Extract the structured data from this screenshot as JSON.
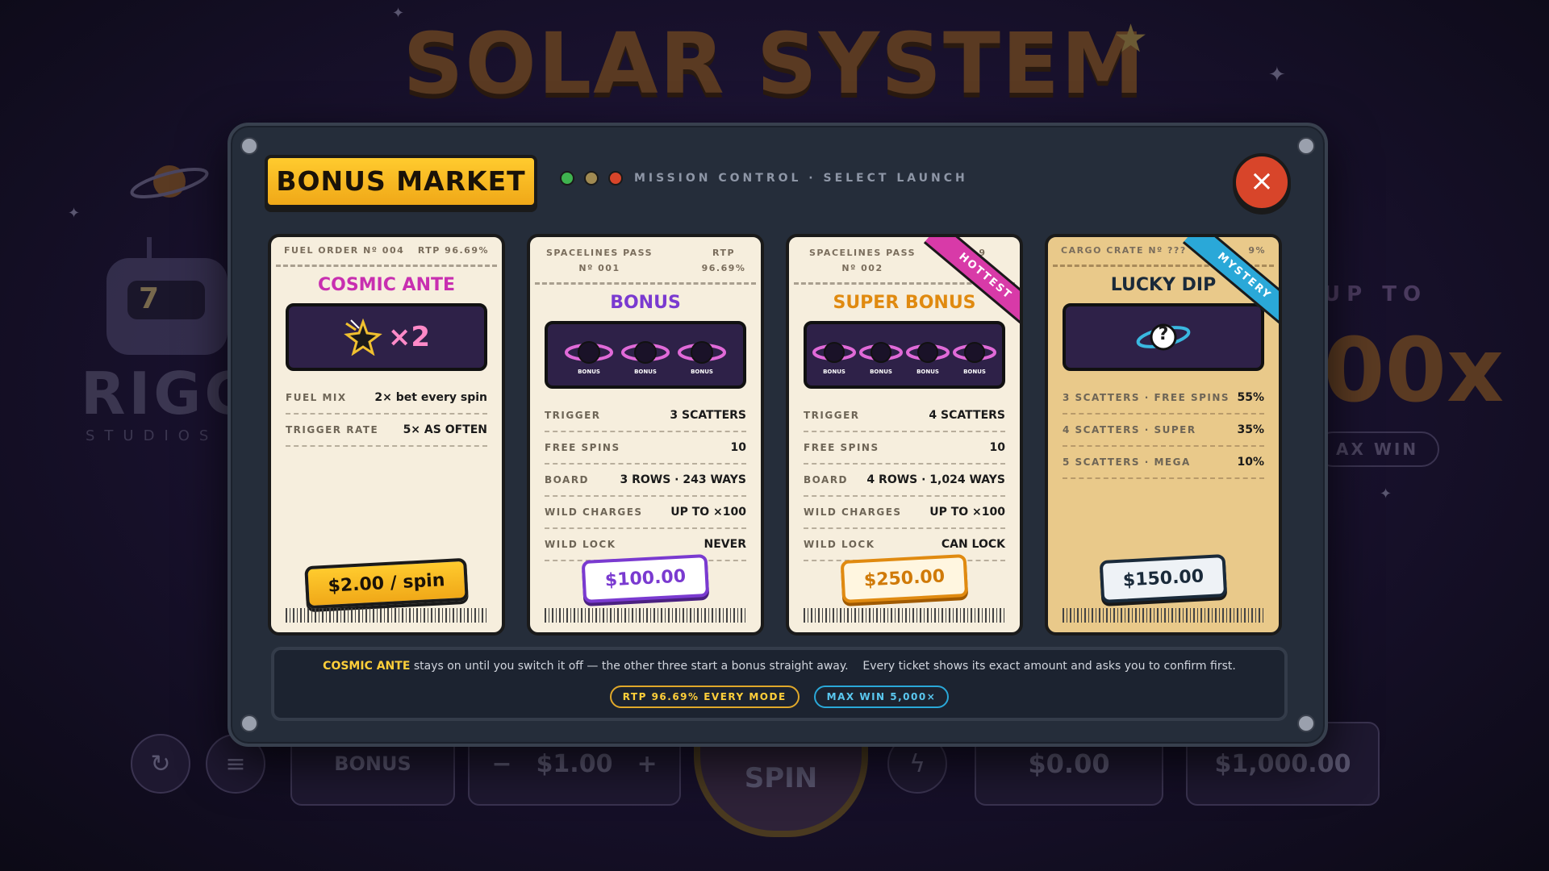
{
  "game": {
    "title": "SOLAR SYSTEM",
    "studio_name": "RIGG",
    "studio_sub": "STUDIOS",
    "studio_logo_glyph": "7",
    "right_upto": "UP TO",
    "right_big": "00x",
    "right_max": "AX WIN",
    "bar": {
      "bonus_label": "BONUS",
      "bet_value": "$1.00",
      "spin_label": "SPIN",
      "win_value": "$0.00",
      "balance_value": "$1,000.00",
      "minus": "−",
      "plus": "+"
    }
  },
  "modal": {
    "title": "BONUS MARKET",
    "subtitle": "MISSION CONTROL · SELECT LAUNCH",
    "status_dots": [
      "#3fb34f",
      "#a08a52",
      "#d8452a"
    ],
    "close_icon": "×",
    "tickets": [
      {
        "head_left": "FUEL ORDER Nº 004",
        "head_right": "RTP 96.69%",
        "name": "COSMIC ANTE",
        "name_color": "#c82fb0",
        "art_text": "×2",
        "rows": [
          {
            "k": "FUEL MIX",
            "v": "2× bet every spin"
          },
          {
            "k": "TRIGGER RATE",
            "v": "5× AS OFTEN"
          }
        ],
        "price": "$2.00 / spin"
      },
      {
        "head_left": "SPACELINES PASS Nº 001",
        "head_right": "RTP 96.69%",
        "name": "BONUS",
        "name_color": "#7a3ad0",
        "art_badge": "BONUS",
        "rows": [
          {
            "k": "TRIGGER",
            "v": "3 SCATTERS"
          },
          {
            "k": "FREE SPINS",
            "v": "10"
          },
          {
            "k": "BOARD",
            "v": "3 ROWS · 243 WAYS"
          },
          {
            "k": "WILD CHARGES",
            "v": "UP TO ×100"
          },
          {
            "k": "WILD LOCK",
            "v": "NEVER"
          }
        ],
        "price": "$100.00"
      },
      {
        "head_left": "SPACELINES PASS Nº 002",
        "head_right": "9",
        "name": "SUPER BONUS",
        "name_color": "#e08a10",
        "ribbon": "HOTTEST",
        "art_badge": "BONUS",
        "rows": [
          {
            "k": "TRIGGER",
            "v": "4 SCATTERS"
          },
          {
            "k": "FREE SPINS",
            "v": "10"
          },
          {
            "k": "BOARD",
            "v": "4 ROWS · 1,024 WAYS"
          },
          {
            "k": "WILD CHARGES",
            "v": "UP TO ×100"
          },
          {
            "k": "WILD LOCK",
            "v": "CAN LOCK"
          }
        ],
        "price": "$250.00"
      },
      {
        "head_left": "CARGO CRATE Nº ???",
        "head_right": "9%",
        "name": "LUCKY DIP",
        "name_color": "#1a2a3a",
        "ribbon": "MYSTERY",
        "art_text": "?",
        "rows": [
          {
            "k": "3 SCATTERS · FREE SPINS",
            "v": "55%"
          },
          {
            "k": "4 SCATTERS · SUPER",
            "v": "35%"
          },
          {
            "k": "5 SCATTERS · MEGA",
            "v": "10%"
          }
        ],
        "price": "$150.00"
      }
    ],
    "footer": {
      "highlight": "COSMIC ANTE",
      "text": "stays on until you switch it off — the other three start a bonus straight away.    Every ticket shows its exact amount and asks you to confirm first.",
      "pill_rtp": "RTP 96.69% EVERY MODE",
      "pill_max": "MAX WIN 5,000×"
    }
  }
}
